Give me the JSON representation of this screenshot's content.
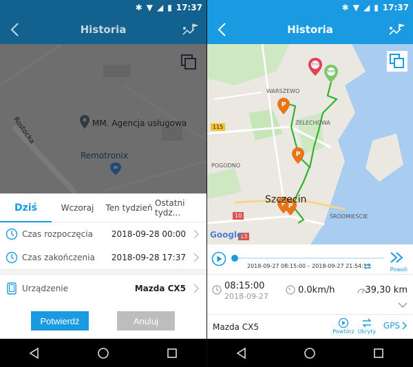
{
  "status": {
    "time": "17:37"
  },
  "left": {
    "title": "Historia",
    "map": {
      "street": "Rostocka",
      "place1": "MM. Agencja usługowa",
      "place2": "Remotronix"
    },
    "tabs": [
      {
        "label": "Dziś"
      },
      {
        "label": "Wczoraj"
      },
      {
        "label": "Ten tydzień"
      },
      {
        "label": "Ostatni tydz..."
      }
    ],
    "rows": {
      "start_label": "Czas rozpoczęcia",
      "start_value": "2018-09-28 00:00",
      "end_label": "Czas zakończenia",
      "end_value": "2018-09-28 17:37",
      "device_label": "Urządzenie",
      "device_value": "Mazda CX5"
    },
    "confirm_label": "Potwierdź",
    "cancel_label": "Anuluj"
  },
  "right": {
    "title": "Historia",
    "map": {
      "district_warszewo": "WARSZEWO",
      "district_zelechowa": "ŻELECHOWA",
      "district_pogodno": "POGODNO",
      "city": "Szczecin",
      "district_srodmiescie": "ŚRÓDMIEŚCIE",
      "road_115": "115",
      "road_10": "10",
      "road_13": "13",
      "google": "Google",
      "end_marker": "End",
      "start_marker": "Start"
    },
    "player": {
      "range": "2018-09-27 08:15:00 – 2018-09-27 21:54:15",
      "slow_label": "Powoli",
      "progress": 0.0
    },
    "stats": {
      "time": "08:15:00",
      "date": "2018-09-27",
      "speed": "0.0km/h",
      "distance": "39,30 km"
    },
    "bottom": {
      "device": "Mazda CX5",
      "repeat_label": "Powtórz",
      "hidden_label": "Ukryty",
      "gps_label": "GPS"
    }
  },
  "colors": {
    "left_header": "#12618f",
    "right_header": "#1a9ae0",
    "route": "#2fb22f",
    "parking_pin": "#e8751a",
    "end_pin": "#e0425a",
    "start_pin": "#7cc96a"
  }
}
